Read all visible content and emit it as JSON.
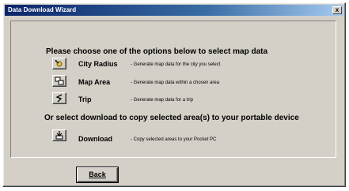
{
  "window": {
    "title": "Data Download Wizard",
    "close_label": "x"
  },
  "main": {
    "heading": "Please choose one of the options below to select map data",
    "options": [
      {
        "label": "City Radius",
        "description": "- Generate map data for the city you select",
        "icon": "city-radius-icon"
      },
      {
        "label": "Map Area",
        "description": "- Generate map data within a chosen area",
        "icon": "map-area-icon"
      },
      {
        "label": "Trip",
        "description": "- Generate map data for a trip",
        "icon": "trip-icon"
      }
    ],
    "download_heading": "Or select download to copy selected area(s) to your portable device",
    "download": {
      "label": "Download",
      "description": "- Copy selected areas to your Pocket PC",
      "icon": "download-icon"
    }
  },
  "footer": {
    "back_label": "Back"
  },
  "colors": {
    "face": "#d4d0c8",
    "title_start": "#0a246a",
    "title_end": "#a6caf0"
  }
}
